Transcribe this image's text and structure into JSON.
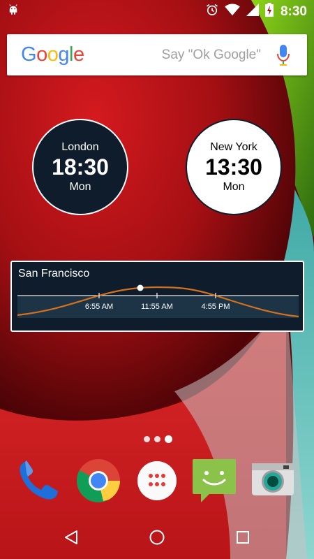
{
  "status_bar": {
    "time": "8:30",
    "icons": [
      "android-debug-icon",
      "alarm-icon",
      "wifi-icon",
      "signal-icon",
      "battery-charging-icon"
    ]
  },
  "search": {
    "logo_letters": [
      "G",
      "o",
      "o",
      "g",
      "l",
      "e"
    ],
    "logo_colors": [
      "#4285F4",
      "#EA4335",
      "#FBBC05",
      "#4285F4",
      "#34A853",
      "#EA4335"
    ],
    "hint": "Say \"Ok Google\""
  },
  "clocks": [
    {
      "city": "London",
      "time": "18:30",
      "day": "Mon",
      "style": "dark"
    },
    {
      "city": "New York",
      "time": "13:30",
      "day": "Mon",
      "style": "light"
    }
  ],
  "daylight": {
    "city": "San Francisco",
    "ticks": [
      "6:55 AM",
      "11:55 AM",
      "4:55 PM"
    ],
    "curve_color": "#d2721f"
  },
  "home": {
    "page_count": 3,
    "active_page": 3
  },
  "dock": [
    {
      "name": "phone-icon",
      "color": "#1e6fd9"
    },
    {
      "name": "chrome-icon",
      "color": "#4285F4"
    },
    {
      "name": "app-drawer-icon",
      "color": "#e53935"
    },
    {
      "name": "messaging-icon",
      "color": "#8bc34a"
    },
    {
      "name": "camera-icon",
      "color": "#26a69a"
    }
  ],
  "nav": [
    "back-icon",
    "home-icon",
    "recents-icon"
  ]
}
